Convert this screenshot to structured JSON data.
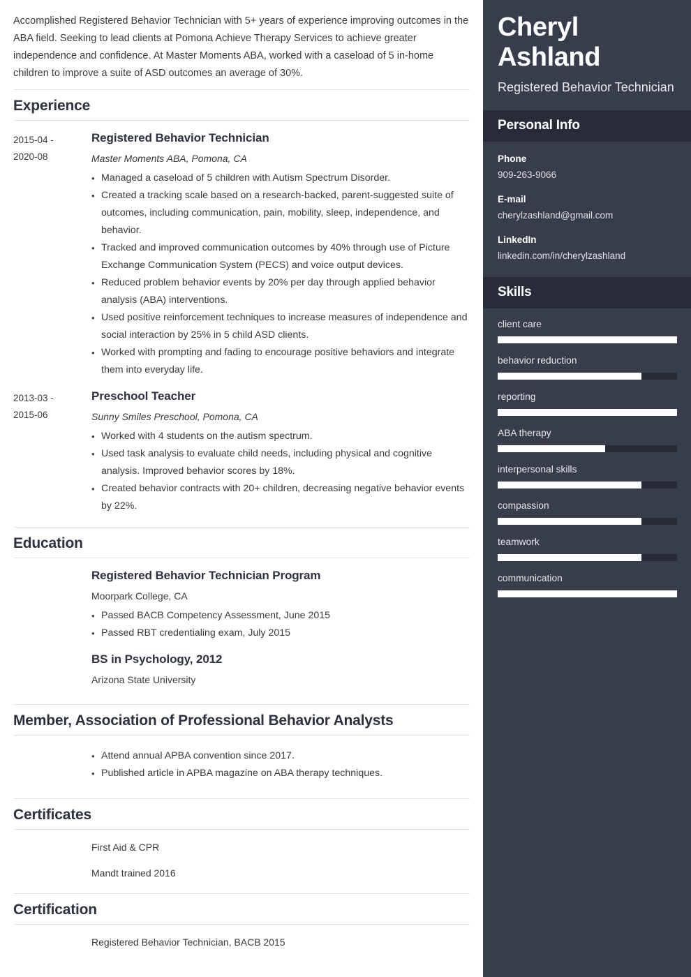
{
  "summary": "Accomplished Registered Behavior Technician with 5+ years of experience improving outcomes in the ABA field. Seeking to lead clients at Pomona Achieve Therapy Services to achieve greater independence and confidence. At Master Moments ABA, worked with a caseload of 5 in-home children to improve a suite of ASD outcomes an average of 30%.",
  "sections": {
    "experience": {
      "heading": "Experience",
      "entries": [
        {
          "dates": "2015-04 - 2020-08",
          "title": "Registered Behavior Technician",
          "subtitle": "Master Moments ABA, Pomona, CA",
          "bullets": [
            "Managed a caseload of 5 children with Autism Spectrum Disorder.",
            "Created a tracking scale based on a research-backed, parent-suggested suite of outcomes, including communication, pain, mobility, sleep, independence, and behavior.",
            "Tracked and improved communication outcomes by 40% through use of Picture Exchange Communication System (PECS) and voice output devices.",
            "Reduced problem behavior events by 20% per day through applied behavior analysis (ABA) interventions.",
            "Used positive reinforcement techniques to increase measures of independence and social interaction by 25% in 5 child ASD clients.",
            "Worked with prompting and fading to encourage positive behaviors and integrate them into everyday life."
          ]
        },
        {
          "dates": "2013-03 - 2015-06",
          "title": "Preschool Teacher",
          "subtitle": "Sunny Smiles Preschool, Pomona, CA",
          "bullets": [
            "Worked with 4 students on the autism spectrum.",
            "Used task analysis to evaluate child needs, including physical and cognitive analysis. Improved behavior scores by 18%.",
            "Created behavior contracts with 20+ children, decreasing negative behavior events by 22%."
          ]
        }
      ]
    },
    "education": {
      "heading": "Education",
      "entries": [
        {
          "dates": "",
          "title": "Registered Behavior Technician Program",
          "subtitle": "Moorpark College, CA",
          "bullets": [
            "Passed BACB Competency Assessment, June 2015",
            "Passed RBT credentialing exam, July 2015"
          ]
        },
        {
          "dates": "",
          "title": "BS in Psychology, 2012",
          "subtitle": "Arizona State University",
          "bullets": []
        }
      ]
    },
    "membership": {
      "heading": "Member, Association of Professional Behavior Analysts",
      "bullets": [
        "Attend annual APBA convention since 2017.",
        "Published article in APBA magazine on ABA therapy techniques."
      ]
    },
    "certificates": {
      "heading": "Certificates",
      "items": [
        "First Aid & CPR",
        "Mandt trained 2016"
      ]
    },
    "certification": {
      "heading": "Certification",
      "items": [
        "Registered Behavior Technician, BACB 2015"
      ]
    }
  },
  "sidebar": {
    "first_name": "Cheryl",
    "last_name": "Ashland",
    "role": "Registered Behavior Technician",
    "personal_info": {
      "heading": "Personal Info",
      "items": [
        {
          "label": "Phone",
          "value": "909-263-9066"
        },
        {
          "label": "E-mail",
          "value": "cherylzashland@gmail.com"
        },
        {
          "label": "LinkedIn",
          "value": "linkedin.com/in/cherylzashland"
        }
      ]
    },
    "skills": {
      "heading": "Skills",
      "items": [
        {
          "name": "client care",
          "level": 100
        },
        {
          "name": "behavior reduction",
          "level": 80
        },
        {
          "name": "reporting",
          "level": 100
        },
        {
          "name": "ABA therapy",
          "level": 60
        },
        {
          "name": "interpersonal skills",
          "level": 80
        },
        {
          "name": "compassion",
          "level": 80
        },
        {
          "name": "teamwork",
          "level": 80
        },
        {
          "name": "communication",
          "level": 100
        }
      ]
    }
  },
  "colors": {
    "sidebar_bg": "#373d4a",
    "sidebar_band_bg": "#272c38",
    "heading": "#2d3240",
    "text": "#3a3a3a",
    "rule": "#e0e0e0",
    "skill_fill": "#ffffff",
    "skill_track": "#262b36"
  }
}
